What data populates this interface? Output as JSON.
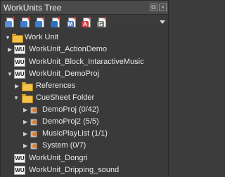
{
  "window": {
    "title": "WorkUnits Tree"
  },
  "toolbar": {
    "buttons": [
      {
        "name": "new-workunit-button",
        "tag": "",
        "tag_color": "#5a8fd8"
      },
      {
        "name": "new-workunit-a-button",
        "tag": "",
        "tag_color": "#3c7fcf"
      },
      {
        "name": "new-workunit-b-button",
        "tag": "",
        "tag_color": "#3c7fcf"
      },
      {
        "name": "new-workunit-c-button",
        "tag": "",
        "tag_color": "#2f6ebd"
      },
      {
        "name": "new-material-button",
        "tag": "M",
        "tag_color": "#3f6fbf"
      },
      {
        "name": "new-aisac-button",
        "tag": "A",
        "tag_color": "#d23b3b"
      },
      {
        "name": "new-gain-button",
        "tag": "G",
        "tag_color": "#7a7a7a"
      }
    ]
  },
  "tree": {
    "root": "Work Unit",
    "items": [
      {
        "label": "WorkUnit_ActionDemo"
      },
      {
        "label": "WorkUnit_Block_IntaractiveMusic"
      },
      {
        "label": "WorkUnit_DemoProj"
      },
      {
        "label": "References"
      },
      {
        "label": "CueSheet Folder"
      },
      {
        "label": "DemoProj (0/42)"
      },
      {
        "label": "DemoProj2 (5/5)"
      },
      {
        "label": "MusicPlayList (1/1)"
      },
      {
        "label": "System (0/7)"
      },
      {
        "label": "WorkUnit_Dongri"
      },
      {
        "label": "WorkUnit_Dripping_sound"
      }
    ],
    "wu_badge": "WU"
  }
}
